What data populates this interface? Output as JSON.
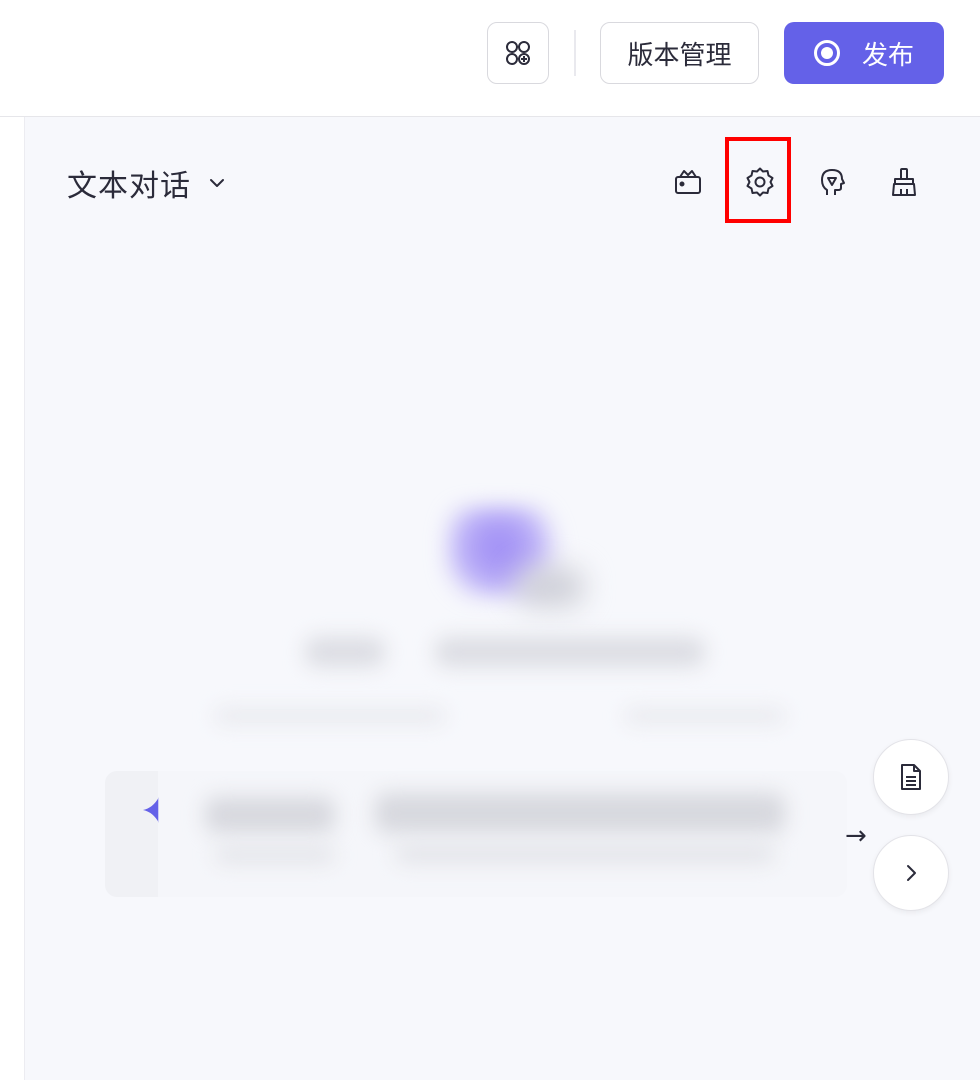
{
  "header": {
    "apps_icon": "command-apps-icon",
    "version_label": "版本管理",
    "publish_label": "发布",
    "publish_icon": "record-circle-icon"
  },
  "chat": {
    "mode_label": "文本对话",
    "mode_icon": "chevron-down-icon",
    "tools": [
      {
        "name": "toolbox-icon"
      },
      {
        "name": "settings-gear-icon"
      },
      {
        "name": "brain-head-icon"
      },
      {
        "name": "broom-clear-icon"
      }
    ],
    "floating": [
      {
        "name": "document-icon"
      },
      {
        "name": "chevron-right-icon"
      }
    ],
    "input_send_icon": "arrow-right-icon",
    "accent": "#6461e8"
  }
}
